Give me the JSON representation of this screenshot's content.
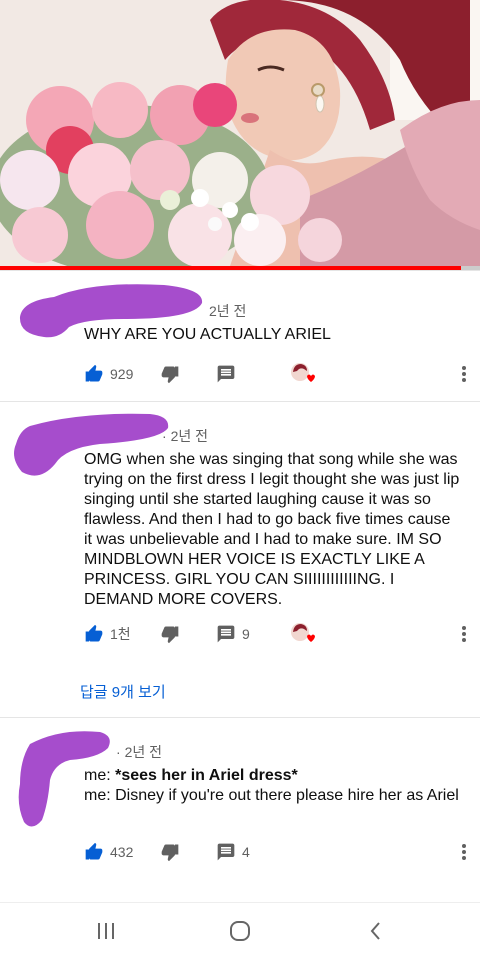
{
  "video": {
    "progress_percent": 96
  },
  "comments": [
    {
      "time": "2년 전",
      "lines": [
        "WHY ARE YOU ACTUALLY ARIEL"
      ],
      "likes": "929",
      "replies_count": ""
    },
    {
      "time": "2년 전",
      "lines": [
        "OMG when she was singing that song while she was trying on the first dress I legit thought she was just lip singing until she started laughing cause it was so flawless. And then I had to go back five times cause it was unbelievable and I had to make sure. IM SO MINDBLOWN HER VOICE IS EXACTLY LIKE A PRINCESS. GIRL YOU CAN SIIIIIIIIIIIING. I DEMAND MORE COVERS."
      ],
      "likes": "1천",
      "replies_count": "9",
      "view_replies": "답글 9개 보기"
    },
    {
      "time": "2년 전",
      "lines": [
        "me: ",
        "*sees her in Ariel dress*",
        "me: Disney if you're out there please hire her as Ariel"
      ],
      "likes": "432",
      "replies_count": "4"
    }
  ],
  "colors": {
    "accent": "#065fd4",
    "progress": "#ff0000",
    "redaction": "#a64dcc"
  },
  "icons": [
    "like-icon",
    "dislike-icon",
    "reply-icon",
    "creator-heart-icon",
    "more-vert-icon",
    "recent-apps-icon",
    "home-icon",
    "back-icon"
  ]
}
